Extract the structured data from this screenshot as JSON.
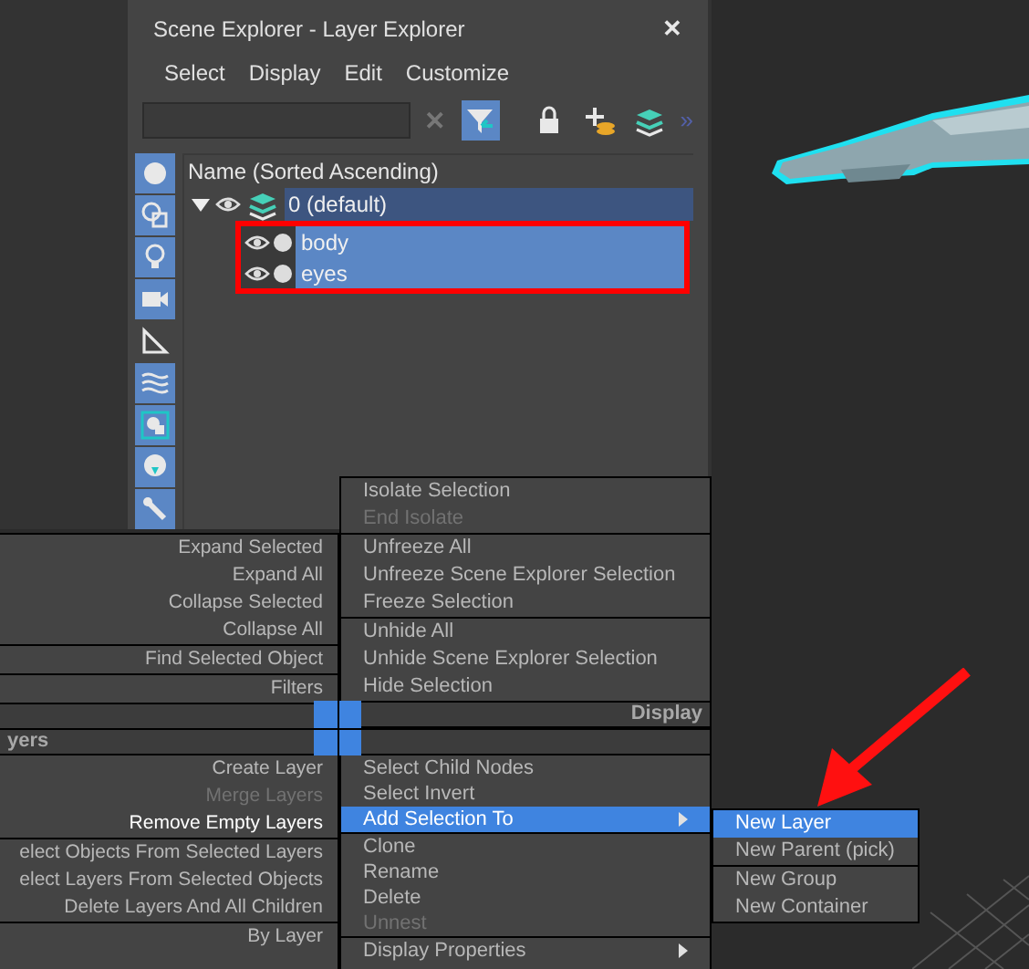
{
  "window": {
    "title": "Scene Explorer - Layer Explorer",
    "close": "✕"
  },
  "menu": [
    "Select",
    "Display",
    "Edit",
    "Customize"
  ],
  "toolbar": {
    "clear": "✕",
    "more": "»",
    "buttons": [
      {
        "kind": "filter",
        "selected": true
      },
      {
        "kind": "lock",
        "selected": false
      },
      {
        "kind": "add-layer",
        "selected": false
      },
      {
        "kind": "layers",
        "selected": false
      }
    ]
  },
  "side_buttons": [
    {
      "kind": "sphere",
      "selected": true
    },
    {
      "kind": "shapes",
      "selected": true
    },
    {
      "kind": "bulb",
      "selected": true
    },
    {
      "kind": "camera",
      "selected": true
    },
    {
      "kind": "ruler",
      "selected": false
    },
    {
      "kind": "waves",
      "selected": true
    },
    {
      "kind": "frame",
      "selected": true
    },
    {
      "kind": "disc",
      "selected": true
    },
    {
      "kind": "pin",
      "selected": true
    }
  ],
  "tree": {
    "header": "Name (Sorted Ascending)",
    "rows": [
      {
        "name": "0 (default)",
        "expanded": true,
        "selected": false,
        "children": [
          {
            "name": "body",
            "selected": true
          },
          {
            "name": "eyes",
            "selected": true
          }
        ]
      }
    ]
  },
  "quad_menu": {
    "top_left": {
      "groups": [
        [
          {
            "label": "Expand Selected",
            "disabled": false,
            "highlighted": false
          },
          {
            "label": "Expand All",
            "disabled": false,
            "highlighted": false
          },
          {
            "label": "Collapse Selected",
            "disabled": false,
            "highlighted": false
          },
          {
            "label": "Collapse All",
            "disabled": false,
            "highlighted": false
          }
        ],
        [
          {
            "label": "Find Selected Object",
            "disabled": false,
            "highlighted": false
          }
        ],
        [
          {
            "label": "Filters",
            "disabled": false,
            "highlighted": false
          }
        ]
      ]
    },
    "top_right": {
      "title": "Display",
      "groups": [
        [
          {
            "label": "Isolate Selection",
            "disabled": false,
            "highlighted": false
          },
          {
            "label": "End Isolate",
            "disabled": true,
            "highlighted": false
          }
        ],
        [
          {
            "label": "Unfreeze All",
            "disabled": false,
            "highlighted": false
          },
          {
            "label": "Unfreeze Scene Explorer Selection",
            "disabled": false,
            "highlighted": false
          },
          {
            "label": "Freeze Selection",
            "disabled": false,
            "highlighted": false
          }
        ],
        [
          {
            "label": "Unhide All",
            "disabled": false,
            "highlighted": false
          },
          {
            "label": "Unhide Scene Explorer Selection",
            "disabled": false,
            "highlighted": false
          },
          {
            "label": "Hide Selection",
            "disabled": false,
            "highlighted": false
          }
        ]
      ]
    },
    "bottom_left": {
      "title": "yers",
      "groups": [
        [
          {
            "label": "Create Layer",
            "disabled": false,
            "highlighted": false
          },
          {
            "label": "Merge Layers",
            "disabled": true,
            "highlighted": false
          },
          {
            "label": "Remove Empty Layers",
            "disabled": false,
            "highlighted": true
          }
        ],
        [
          {
            "label": "elect Objects From Selected Layers",
            "disabled": false,
            "highlighted": false
          },
          {
            "label": "elect Layers From Selected Objects",
            "disabled": false,
            "highlighted": false
          },
          {
            "label": "Delete Layers And All Children",
            "disabled": false,
            "highlighted": false
          }
        ],
        [
          {
            "label": "By Layer",
            "disabled": false,
            "highlighted": false
          }
        ]
      ]
    },
    "bottom_right": {
      "groups": [
        [
          {
            "label": "Select Child Nodes",
            "disabled": false,
            "highlighted": false,
            "submenu": false
          },
          {
            "label": "Select Invert",
            "disabled": false,
            "highlighted": false,
            "submenu": false
          },
          {
            "label": "Add Selection To",
            "disabled": false,
            "highlighted": true,
            "submenu": true
          }
        ],
        [
          {
            "label": "Clone",
            "disabled": false,
            "highlighted": false,
            "submenu": false
          },
          {
            "label": "Rename",
            "disabled": false,
            "highlighted": false,
            "submenu": false
          },
          {
            "label": "Delete",
            "disabled": false,
            "highlighted": false,
            "submenu": false
          },
          {
            "label": "Unnest",
            "disabled": true,
            "highlighted": false,
            "submenu": false
          }
        ],
        [
          {
            "label": "Display Properties",
            "disabled": false,
            "highlighted": false,
            "submenu": true
          }
        ]
      ]
    }
  },
  "submenu": {
    "groups": [
      [
        {
          "label": "New Layer",
          "disabled": false,
          "highlighted": true
        },
        {
          "label": "New Parent (pick)",
          "disabled": false,
          "highlighted": false
        }
      ],
      [
        {
          "label": "New Group",
          "disabled": false,
          "highlighted": false
        },
        {
          "label": "New Container",
          "disabled": false,
          "highlighted": false
        }
      ]
    ]
  }
}
